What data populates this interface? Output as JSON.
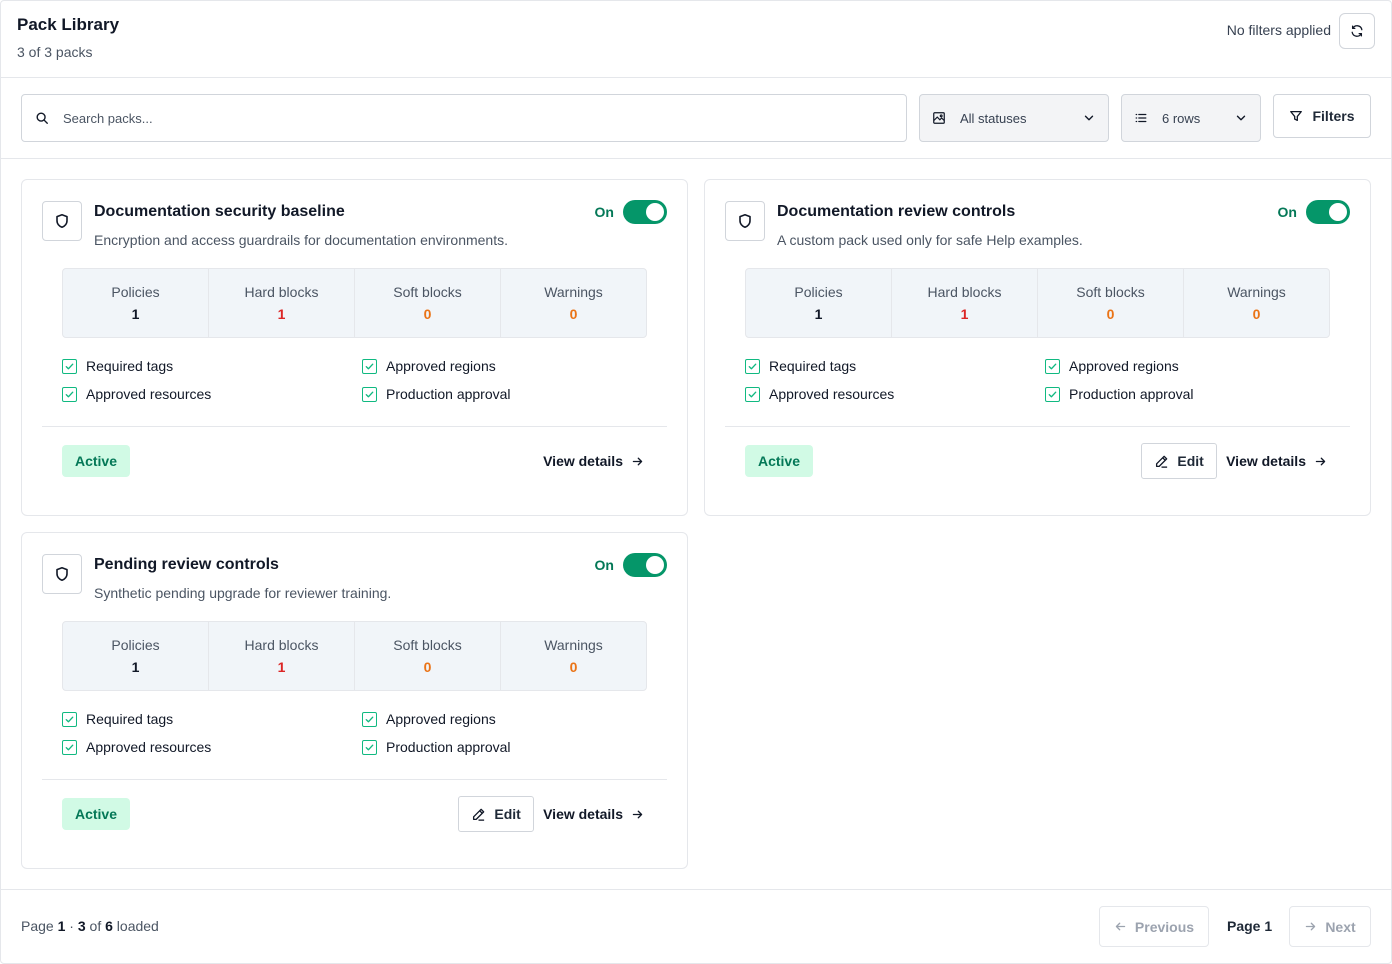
{
  "header": {
    "title": "Pack Library",
    "subtitle": "3 of 3 packs",
    "filters_status": "No filters applied",
    "refresh_icon": "refresh-icon"
  },
  "toolbar": {
    "search_placeholder": "Search packs...",
    "status_select": "All statuses",
    "rows_select": "6 rows",
    "filters_label": "Filters"
  },
  "cards": [
    {
      "title": "Documentation security baseline",
      "description": "Encryption and access guardrails for documentation environments.",
      "toggle_label": "On",
      "stats": [
        {
          "label": "Policies",
          "value": "1"
        },
        {
          "label": "Hard blocks",
          "value": "1"
        },
        {
          "label": "Soft blocks",
          "value": "0"
        },
        {
          "label": "Warnings",
          "value": "0"
        }
      ],
      "checks": [
        "Required tags",
        "Approved regions",
        "Approved resources",
        "Production approval"
      ],
      "status": "Active",
      "edit_label": "",
      "view_label": "View details"
    },
    {
      "title": "Documentation review controls",
      "description": "A custom pack used only for safe Help examples.",
      "toggle_label": "On",
      "stats": [
        {
          "label": "Policies",
          "value": "1"
        },
        {
          "label": "Hard blocks",
          "value": "1"
        },
        {
          "label": "Soft blocks",
          "value": "0"
        },
        {
          "label": "Warnings",
          "value": "0"
        }
      ],
      "checks": [
        "Required tags",
        "Approved regions",
        "Approved resources",
        "Production approval"
      ],
      "status": "Active",
      "edit_label": "Edit",
      "view_label": "View details"
    },
    {
      "title": "Pending review controls",
      "description": "Synthetic pending upgrade for reviewer training.",
      "toggle_label": "On",
      "stats": [
        {
          "label": "Policies",
          "value": "1"
        },
        {
          "label": "Hard blocks",
          "value": "1"
        },
        {
          "label": "Soft blocks",
          "value": "0"
        },
        {
          "label": "Warnings",
          "value": "0"
        }
      ],
      "checks": [
        "Required tags",
        "Approved regions",
        "Approved resources",
        "Production approval"
      ],
      "status": "Active",
      "edit_label": "Edit",
      "view_label": "View details"
    }
  ],
  "footer": {
    "page_label": "Page",
    "page_num": "1",
    "sep": "·",
    "loaded_count": "3",
    "of_label": "of",
    "total": "6",
    "loaded_label": "loaded",
    "previous_label": "Previous",
    "current_page": "Page 1",
    "next_label": "Next"
  },
  "colors": {
    "accent": "#059669",
    "active_badge_bg": "#d1fae5",
    "hard_block": "#dc2626",
    "soft_block": "#ea7316"
  }
}
